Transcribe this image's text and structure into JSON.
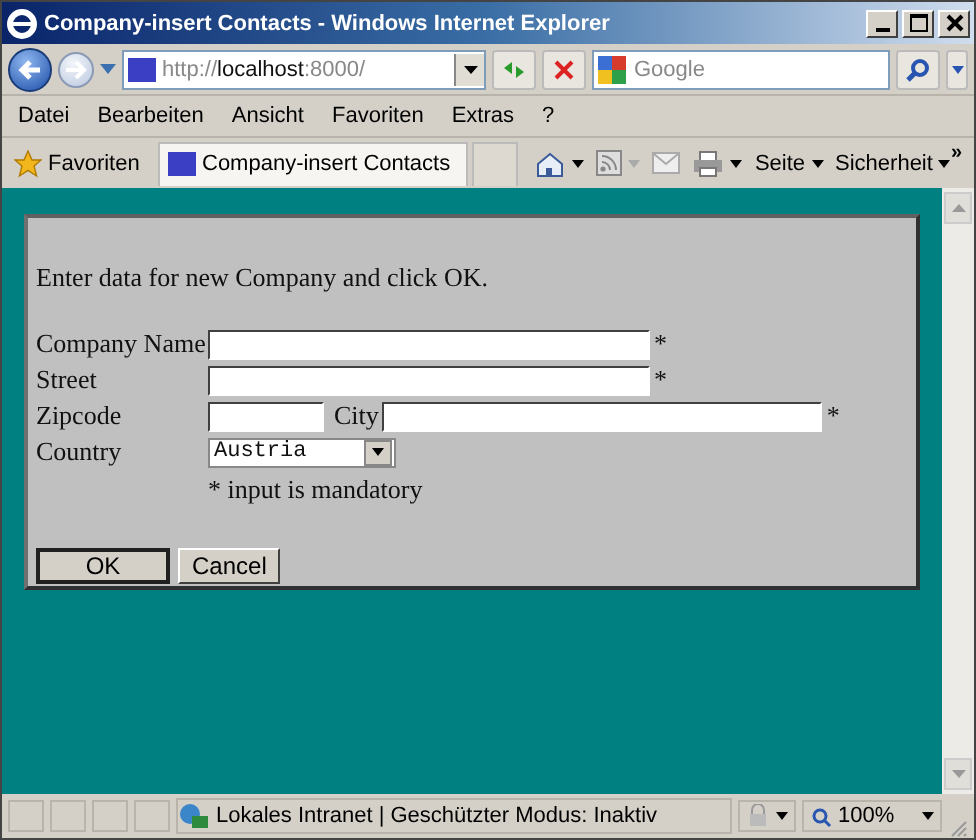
{
  "window": {
    "title": "Company-insert Contacts - Windows Internet Explorer"
  },
  "address_bar": {
    "url_prefix": "http://",
    "url_host": "localhost",
    "url_suffix": ":8000/"
  },
  "search": {
    "placeholder": "Google"
  },
  "menu": [
    "Datei",
    "Bearbeiten",
    "Ansicht",
    "Favoriten",
    "Extras",
    "?"
  ],
  "favorites_bar": {
    "favorites": "Favoriten",
    "tab": "Company-insert Contacts",
    "commands": [
      {
        "kind": "home"
      },
      {
        "kind": "feed"
      },
      {
        "kind": "mail"
      },
      {
        "kind": "print"
      },
      {
        "kind": "text",
        "label": "Seite"
      },
      {
        "kind": "text",
        "label": "Sicherheit"
      }
    ],
    "more": "»"
  },
  "form": {
    "intro": "Enter data for new Company and click OK.",
    "fields": [
      {
        "label": "Company Name",
        "mandatory": true
      },
      {
        "label": "Street",
        "mandatory": true
      }
    ],
    "zip": {
      "label": "Zipcode"
    },
    "city": {
      "label": "City",
      "mandatory": true
    },
    "country": {
      "label": "Country",
      "value": "Austria"
    },
    "note": "* input is mandatory",
    "mark": "*",
    "buttons": [
      {
        "label": "OK",
        "default": true
      },
      {
        "label": "Cancel",
        "default": false
      }
    ]
  },
  "status_bar": {
    "zone": "Lokales Intranet | Geschützter Modus: Inaktiv",
    "zoom": "100%"
  }
}
